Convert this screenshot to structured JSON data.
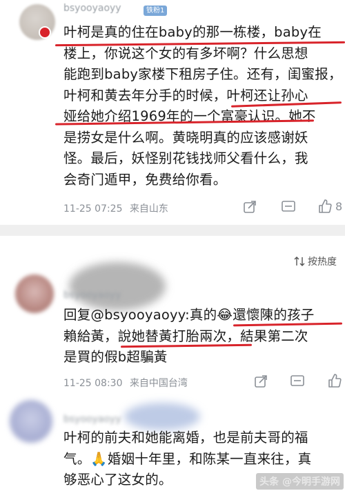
{
  "comments": [
    {
      "user": "bsyooyaoyy",
      "badge": "铁粉1",
      "lines": [
        "叶柯是真的住在baby的那一栋楼，baby在",
        "楼上，你说这个女的有多坏啊？什么思想",
        "能跑到baby家楼下租房子住。还有，闺蜜报，",
        "叶柯和黄去年分手的时候，叶柯还让孙心",
        "娅给她介绍1969年的一个富豪认识。她不",
        "是捞女是什么啊。黄晓明真的应该感谢妖",
        "怪。最后，妖怪别花钱找师父看什么，我",
        "会奇门遁甲，免费给你看。"
      ],
      "time": "11-25 07:25",
      "location": "来自山东",
      "likes": "8"
    },
    {
      "user": "bsyooyaoyy",
      "reply_prefix": "回复@",
      "reply_user": "bsyooyaoyy",
      "lines": [
        "回复@bsyooyaoyy:真的😂還懷陳的孩子",
        "賴給黃，說她替黃打胎兩次，結果第二次",
        "是買的假b超騙黃"
      ],
      "time": "11-25 08:30",
      "location": "来自中国台湾"
    },
    {
      "user": "bsyooyaoyy",
      "lines": [
        "叶柯的前夫和她能离婚，也是前夫哥的福",
        "气。🙏婚姻十年里，和陈某一直来往，真",
        "够恶心了这女的。"
      ]
    }
  ],
  "sort_label": "按热度",
  "watermark": "头条 @今明手游网",
  "colors": {
    "underline": "#d8232a",
    "meta": "#8a8f96",
    "divider": "#efefef"
  }
}
